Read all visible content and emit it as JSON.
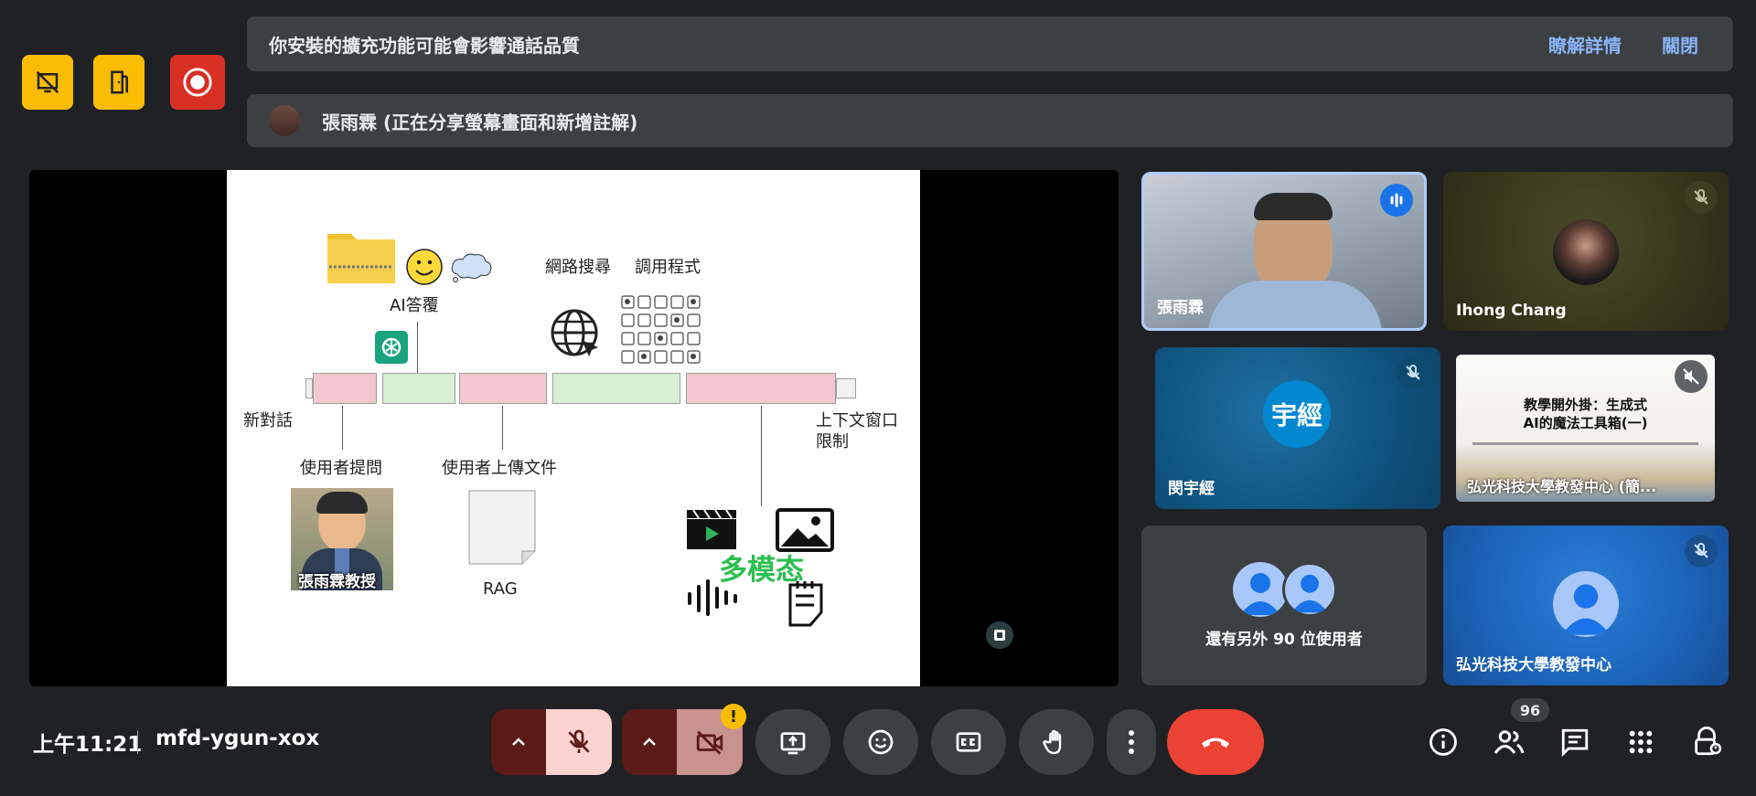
{
  "host_controls": [
    {
      "icon": "no-present-icon"
    },
    {
      "icon": "door-exit-icon"
    },
    {
      "icon": "record-icon"
    }
  ],
  "extension_banner": {
    "message": "你安裝的擴充功能可能會影響通話品質",
    "learn_more": "瞭解詳情",
    "close": "關閉"
  },
  "share_banner": {
    "message": "張雨霖 (正在分享螢幕畫面和新增註解)"
  },
  "slide": {
    "ai_reply": "AI答覆",
    "web_search": "網路搜尋",
    "call_program": "調用程式",
    "new_chat": "新對話",
    "context_window": "上下文窗口",
    "limit": "限制",
    "user_question": "使用者提問",
    "user_upload": "使用者上傳文件",
    "professor": "張雨霖教授",
    "rag": "RAG",
    "multimodal": "多模态"
  },
  "participants": [
    {
      "name": "張雨霖",
      "speaking": true
    },
    {
      "name": "Ihong Chang",
      "muted": true
    },
    {
      "name": "閔宇經",
      "initials": "宇經",
      "muted": true
    },
    {
      "name": "弘光科技大學教發中心 (簡...",
      "muted": true,
      "slide_title_1": "教學開外掛：生成式",
      "slide_title_2": "AI的魔法工具箱(一)"
    },
    {
      "name": "弘光科技大學教發中心",
      "muted": true
    }
  ],
  "others": {
    "label": "還有另外 90 位使用者"
  },
  "meeting": {
    "time": "上午11:21",
    "code": "mfd-ygun-xox",
    "people_count": "96"
  },
  "colors": {
    "accent_blue": "#8ab4f8",
    "end_call_red": "#ea4335",
    "host_yellow": "#fbbc04",
    "mic_off_pink": "#fad2cf"
  }
}
